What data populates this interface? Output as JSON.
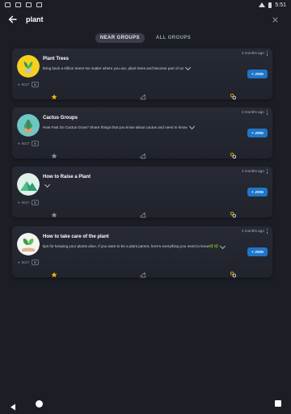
{
  "status_bar": {
    "time": "5:51",
    "icons": [
      "notification-icon",
      "notification-icon",
      "notification-icon",
      "notification-icon",
      "wifi-icon",
      "battery-icon"
    ]
  },
  "search": {
    "value": "plant",
    "back_icon": "back-arrow-icon",
    "clear_icon": "close-icon"
  },
  "tabs": [
    {
      "label": "NEAR GROUPS",
      "active": true
    },
    {
      "label": "ALL GROUPS",
      "active": false
    }
  ],
  "groups": [
    {
      "title": "Plant Trees",
      "description": "bring back a trillion trees! No matter where you are,  plant trees and become part of us",
      "date": "2 months ago",
      "location": "8027",
      "join_label": "+ JOIN",
      "starred": true
    },
    {
      "title": "Cactus Groups",
      "description": "How Fast Do Cactus Grow? Share things that you know about cactus and need to know",
      "date": "2 months ago",
      "location": "8027",
      "join_label": "+ JOIN",
      "starred": false
    },
    {
      "title": "How to Raise a Plant",
      "description": "",
      "date": "2 months ago",
      "location": "8027",
      "join_label": "+ JOIN",
      "starred": false
    },
    {
      "title": "How to take care of the plant",
      "description": "tips for keeping your plants alive, If you want to be a plant parent, here's everything you need to know🌿🌿",
      "date": "2 months ago",
      "location": "8027",
      "join_label": "+ JOIN",
      "starred": true
    }
  ],
  "colors": {
    "background": "#1c1e26",
    "card": "#252832",
    "join_button": "#1f75c9",
    "star_active": "#f5b301",
    "star_inactive": "#8a8f9b"
  }
}
